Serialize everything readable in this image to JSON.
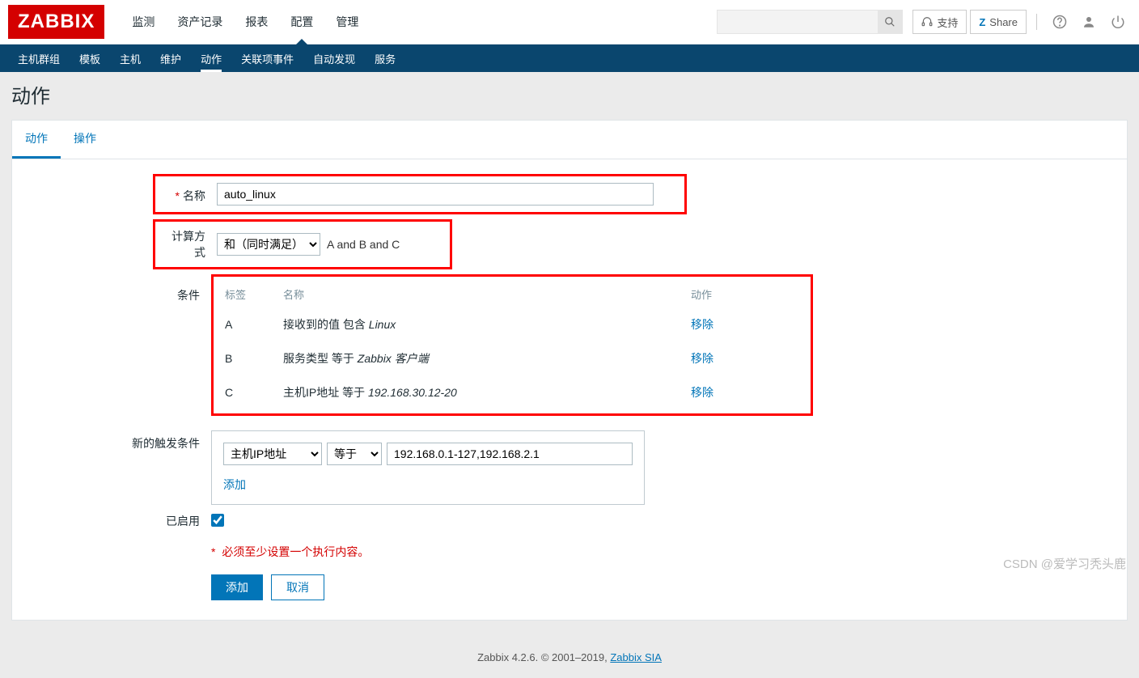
{
  "header": {
    "logo": "ZABBIX",
    "main_nav": [
      "监测",
      "资产记录",
      "报表",
      "配置",
      "管理"
    ],
    "main_nav_active": 3,
    "support": "支持",
    "share": "Share"
  },
  "sub_nav": {
    "items": [
      "主机群组",
      "模板",
      "主机",
      "维护",
      "动作",
      "关联项事件",
      "自动发现",
      "服务"
    ],
    "active": 4
  },
  "page": {
    "title": "动作",
    "tabs": [
      "动作",
      "操作"
    ],
    "active_tab": 0
  },
  "form": {
    "name_label": "名称",
    "name_value": "auto_linux",
    "calc_label": "计算方式",
    "calc_value": "和（同时满足）",
    "calc_formula": "A and B and C",
    "conditions_label": "条件",
    "cond_headers": {
      "tag": "标签",
      "name": "名称",
      "action": "动作"
    },
    "conditions": [
      {
        "tag": "A",
        "name": "接收到的值 包含 ",
        "italic": "Linux",
        "action": "移除"
      },
      {
        "tag": "B",
        "name": "服务类型 等于 ",
        "italic": "Zabbix 客户端",
        "action": "移除"
      },
      {
        "tag": "C",
        "name": "主机IP地址 等于 ",
        "italic": "192.168.30.12-20",
        "action": "移除"
      }
    ],
    "new_cond_label": "新的触发条件",
    "new_cond": {
      "type": "主机IP地址",
      "op": "等于",
      "value": "192.168.0.1-127,192.168.2.1",
      "add": "添加"
    },
    "enabled_label": "已启用",
    "enabled": true,
    "warn_text": "必须至少设置一个执行内容。",
    "btn_add": "添加",
    "btn_cancel": "取消"
  },
  "footer": {
    "text": "Zabbix 4.2.6. © 2001–2019, ",
    "link": "Zabbix SIA"
  },
  "watermark": "CSDN @爱学习秃头鹿"
}
